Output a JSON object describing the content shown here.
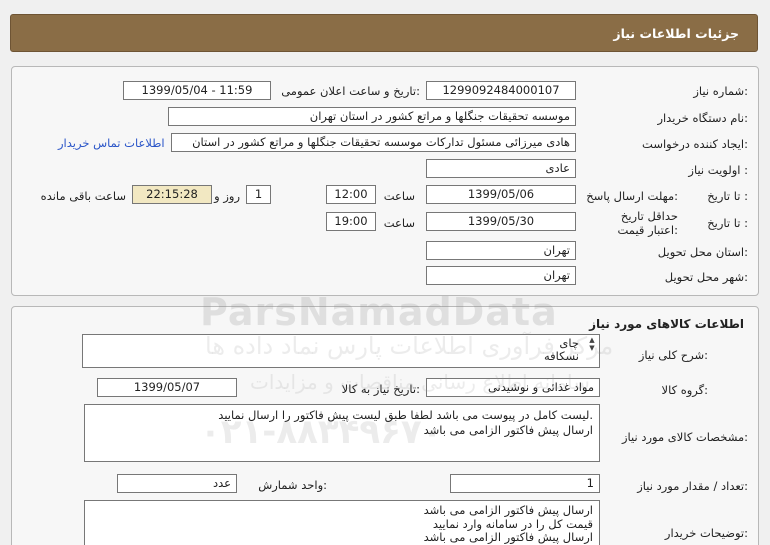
{
  "header": {
    "title": "جزئیات اطلاعات نیاز"
  },
  "fields": {
    "need_number_label": "شماره نیاز:",
    "need_number": "1299092484000107",
    "announce_label": "تاریخ و ساعت اعلان عمومی:",
    "announce_value": "1399/05/04 - 11:59",
    "buyer_label": "نام دستگاه خریدار:",
    "buyer_value": "موسسه تحقیقات جنگلها و مراتع کشور در استان تهران",
    "creator_label": "ایجاد کننده درخواست:",
    "creator_value": "هادی میرزائی مسئول تدارکات موسسه تحقیقات جنگلها و مراتع کشور در استان",
    "contact_link": "اطلاعات تماس خریدار",
    "priority_label": "اولویت نیاز :",
    "priority_value": "عادی",
    "reply_deadline_label": "مهلت ارسال پاسخ:",
    "to_date_label": "تا تاریخ :",
    "reply_date": "1399/05/06",
    "hour_label": "ساعت",
    "reply_time": "12:00",
    "days_value": "1",
    "days_label": "روز و",
    "remaining_time": "22:15:28",
    "remaining_label": "ساعت باقی مانده",
    "validity_label": "حداقل تاریخ اعتبار قیمت:",
    "validity_date": "1399/05/30",
    "validity_time": "19:00",
    "province_label": "استان محل تحویل:",
    "province_value": "تهران",
    "city_label": "شهر محل تحویل:",
    "city_value": "تهران"
  },
  "goods": {
    "section_title": "اطلاعات کالاهای مورد نیاز",
    "desc_label": "شرح کلی نیاز:",
    "desc_line1": "چای",
    "desc_line2": "نسکافه",
    "group_label": "گروه کالا:",
    "group_value": "مواد غذائی و نوشیدنی",
    "need_date_label": "تاریخ نیاز به کالا:",
    "need_date_value": "1399/05/07",
    "spec_label": "مشخصات کالای مورد نیاز:",
    "spec_line1": "لیست کامل در پیوست می باشد لطفا طبق لیست پیش فاکتور را ارسال نمایید.",
    "spec_line2": "ارسال پیش فاکتور الزامی می باشد",
    "qty_label": "تعداد / مقدار مورد نیاز:",
    "qty_value": "1",
    "unit_label": "واحد شمارش:",
    "unit_value": "عدد",
    "notes_label": "توضیحات خریدار:",
    "notes_line1": "ارسال پیش فاکتور الزامی می باشد",
    "notes_line2": "قیمت کل را در سامانه وارد نمایید",
    "notes_line3": "ارسال پیش فاکتور الزامی می باشد"
  },
  "watermark": {
    "brand": "ParsNamadData",
    "line1": "مرکز فرآوری اطلاعات پارس نماد داده ها",
    "line2": "سامانه اطلاع رسانی مناقصات و مزایدات",
    "phone": "۰۲۱-۸۸۳۴۹۶۷۰"
  }
}
